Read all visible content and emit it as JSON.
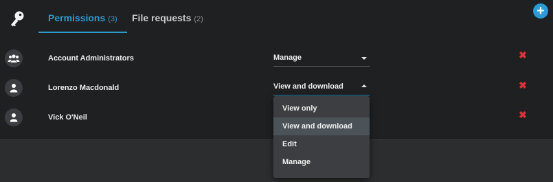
{
  "tabs": [
    {
      "label": "Permissions",
      "count": "(3)",
      "active": true
    },
    {
      "label": "File requests",
      "count": "(2)",
      "active": false
    }
  ],
  "icons": {
    "tab_icon": "key-icon",
    "add": "plus-icon",
    "group": "group-icon",
    "user": "user-icon",
    "remove": "close-icon",
    "caret": "chevron-down-icon"
  },
  "add_button": {
    "glyph": "+"
  },
  "rows": [
    {
      "name": "Account Administrators",
      "permission": "Manage",
      "avatar": "group",
      "remove_glyph": "✖"
    },
    {
      "name": "Lorenzo Macdonald",
      "permission": "View and download",
      "avatar": "user",
      "remove_glyph": "✖"
    },
    {
      "name": "Vick O'Neil",
      "permission": "",
      "avatar": "user",
      "remove_glyph": "✖"
    }
  ],
  "dropdown": {
    "options": [
      "View only",
      "View and download",
      "Edit",
      "Manage"
    ],
    "selected": "View and download"
  },
  "colors": {
    "accent": "#2b9bd1",
    "remove": "#d8343a",
    "panel_bg": "#1f2022",
    "page_bg": "#2c2d2f"
  }
}
